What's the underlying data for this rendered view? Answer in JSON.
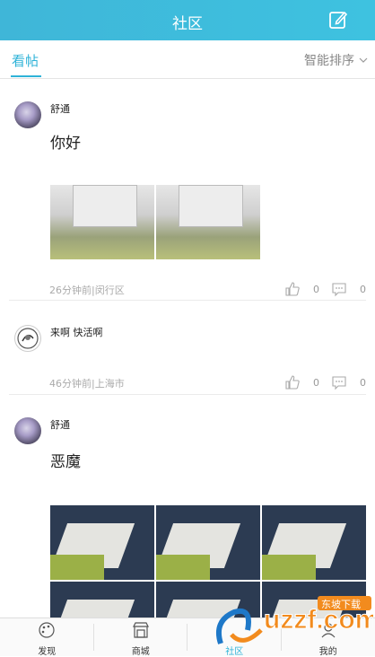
{
  "header": {
    "title": "社区"
  },
  "subnav": {
    "active_tab": "看帖",
    "sort_label": "智能排序"
  },
  "posts": [
    {
      "author": "舒通",
      "content": "你好",
      "meta": "26分钟前|闵行区",
      "likes": "0",
      "comments": "0"
    },
    {
      "author": "来啊  快活啊",
      "content": "",
      "meta": "46分钟前|上海市",
      "likes": "0",
      "comments": "0"
    },
    {
      "author": "舒通",
      "content": "恶魔"
    }
  ],
  "bottom_nav": [
    {
      "label": "发现"
    },
    {
      "label": "商城"
    },
    {
      "label": "社区"
    },
    {
      "label": "我的"
    }
  ],
  "watermark": {
    "text": "uzzf.com",
    "subtext": "东坡下载"
  }
}
